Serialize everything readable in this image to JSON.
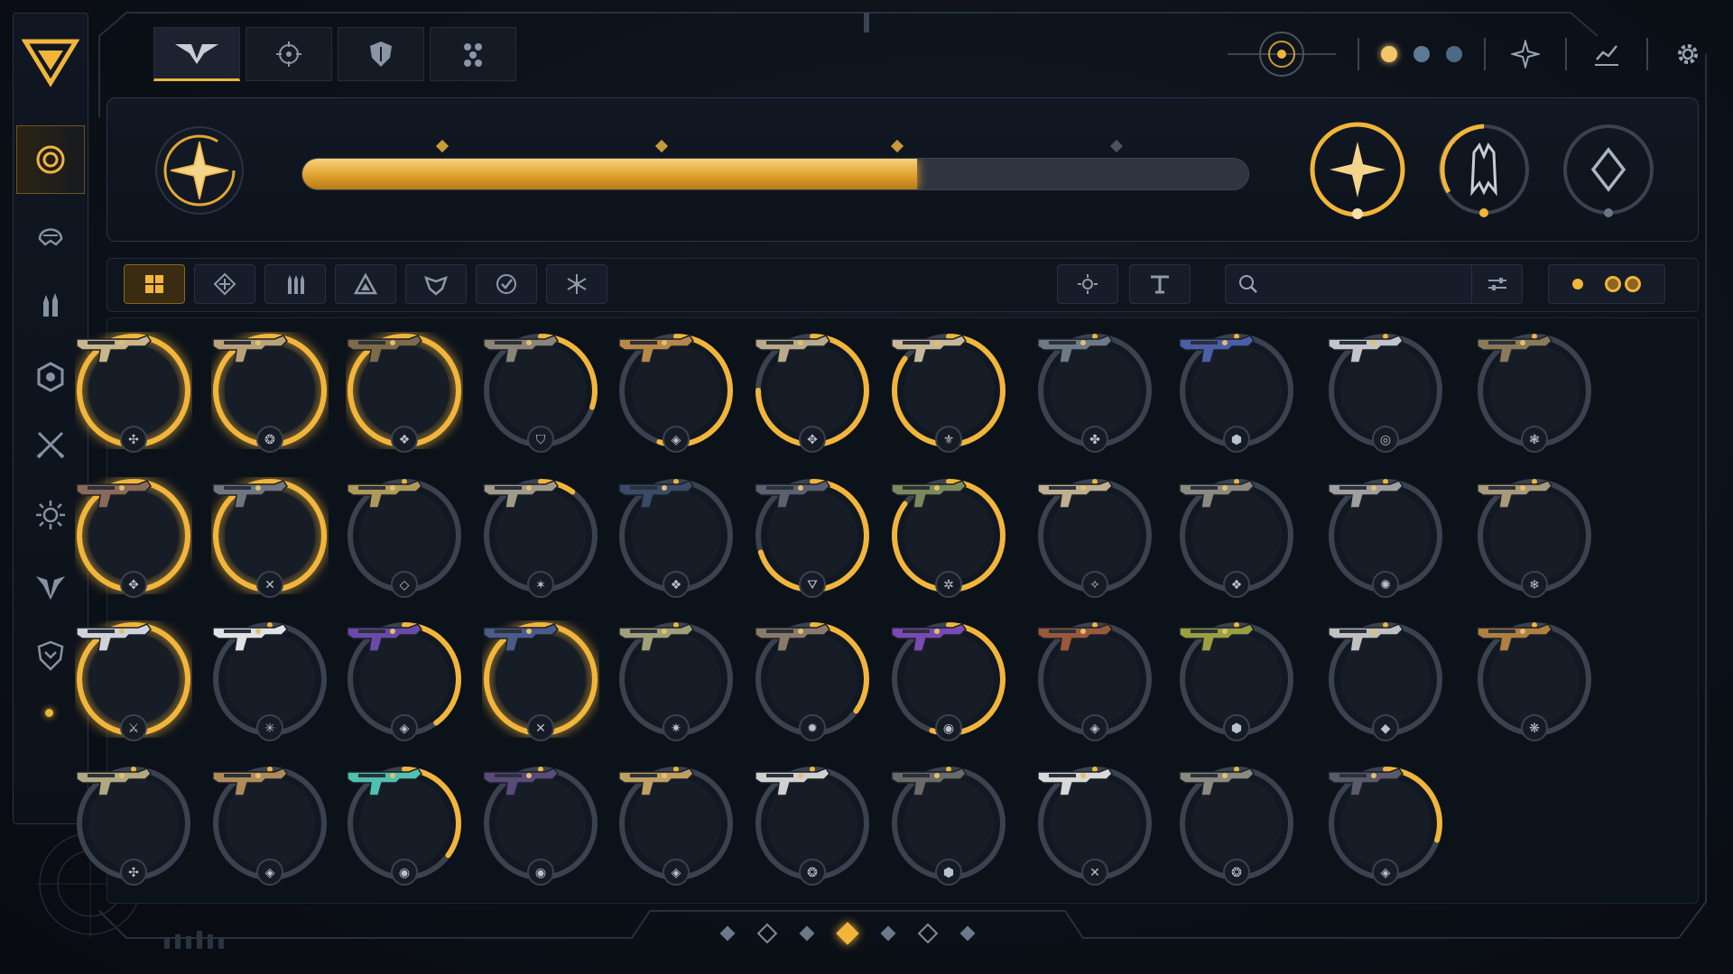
{
  "colors": {
    "gold": "#f2b53a",
    "ring_dim": "#3a4250",
    "bg": "#0b0f16"
  },
  "rail": {
    "logo": "triangle-emblem-icon",
    "items": [
      {
        "icon": "target-icon",
        "active": true
      },
      {
        "icon": "helmet-icon",
        "active": false
      },
      {
        "icon": "ammo-icon",
        "active": false
      },
      {
        "icon": "hexagon-icon",
        "active": false
      },
      {
        "icon": "crossed-swords-icon",
        "active": false
      },
      {
        "icon": "sunburst-icon",
        "active": false
      },
      {
        "icon": "winged-emblem-icon",
        "active": false
      },
      {
        "icon": "shield-crest-icon",
        "active": false
      }
    ]
  },
  "topnav": {
    "tabs": [
      {
        "icon": "wing-emblem-icon",
        "active": true
      },
      {
        "icon": "crosshair-icon",
        "active": false
      },
      {
        "icon": "shield-icon",
        "active": false
      },
      {
        "icon": "cluster-icon",
        "active": false
      }
    ]
  },
  "top_right": {
    "icons": [
      "radar-icon",
      "star-diamond-icon",
      "chart-icon",
      "gear-icon"
    ],
    "status_dots": [
      "#f4c66a",
      "#5c7a96",
      "#4b6a86"
    ]
  },
  "hero": {
    "emblem": "compass-star-icon",
    "progress": 0.65,
    "ranks": [
      {
        "icon": "compass-star-icon",
        "fill": 1.0
      },
      {
        "icon": "ghost-shell-icon",
        "fill": 0.55
      },
      {
        "icon": "diamond-icon",
        "fill": 0.0
      }
    ]
  },
  "filters": {
    "buttons": [
      {
        "icon": "grid-icon",
        "active": true
      },
      {
        "icon": "diamond-cross-icon",
        "active": false
      },
      {
        "icon": "bullets-icon",
        "active": false
      },
      {
        "icon": "triangle-icon",
        "active": false
      },
      {
        "icon": "crest-icon",
        "active": false
      },
      {
        "icon": "check-circle-icon",
        "active": false
      },
      {
        "icon": "snowflake-icon",
        "active": false
      }
    ],
    "sort_icons": [
      "sun-icon",
      "funnel-icon"
    ],
    "search_placeholder": "",
    "search_value": ""
  },
  "weapons": {
    "rows": [
      [
        {
          "fill": 1.0,
          "tint": "#c9b58a",
          "sym": "✣"
        },
        {
          "fill": 1.0,
          "tint": "#b9a27a",
          "sym": "❂"
        },
        {
          "fill": 1.0,
          "tint": "#7d6a48",
          "sym": "❖"
        },
        {
          "fill": 0.3,
          "tint": "#8a8578",
          "sym": "⛉"
        },
        {
          "fill": 0.55,
          "tint": "#b8874a",
          "sym": "◈"
        },
        {
          "fill": 0.75,
          "tint": "#b8aa8a",
          "sym": "✥"
        },
        {
          "fill": 0.85,
          "tint": "#c8b89a",
          "sym": "⚜"
        },
        {
          "fill": 0.0,
          "tint": "#6e7a88",
          "sym": "✤"
        },
        {
          "fill": 0.0,
          "tint": "#4b5fa8",
          "sym": "⬢"
        },
        {
          "fill": 0.0,
          "tint": "#c2c6cc",
          "sym": "◎"
        },
        {
          "fill": 0.0,
          "tint": "#8a7a5a",
          "sym": "❃"
        }
      ],
      [
        {
          "fill": 1.0,
          "tint": "#8a6a5a",
          "sym": "✥"
        },
        {
          "fill": 1.0,
          "tint": "#707680",
          "sym": "✕"
        },
        {
          "fill": 0.0,
          "tint": "#b09a5a",
          "sym": "◇"
        },
        {
          "fill": 0.1,
          "tint": "#a09a88",
          "sym": "✶"
        },
        {
          "fill": 0.0,
          "tint": "#3a4a6a",
          "sym": "❖"
        },
        {
          "fill": 0.7,
          "tint": "#5a6070",
          "sym": "⛛"
        },
        {
          "fill": 0.85,
          "tint": "#7a8a5a",
          "sym": "✲"
        },
        {
          "fill": 0.0,
          "tint": "#c0b090",
          "sym": "✧"
        },
        {
          "fill": 0.0,
          "tint": "#8a8a80",
          "sym": "❖"
        },
        {
          "fill": 0.0,
          "tint": "#a0a0a0",
          "sym": "✺"
        },
        {
          "fill": 0.0,
          "tint": "#a89a7a",
          "sym": "❄"
        }
      ],
      [
        {
          "fill": 1.0,
          "tint": "#d0d4da",
          "sym": "⚔"
        },
        {
          "fill": 0.0,
          "tint": "#e0e2e6",
          "sym": "✳"
        },
        {
          "fill": 0.4,
          "tint": "#6a4aa8",
          "sym": "◈"
        },
        {
          "fill": 1.0,
          "tint": "#4a5a8a",
          "sym": "✕"
        },
        {
          "fill": 0.0,
          "tint": "#a0a078",
          "sym": "✷"
        },
        {
          "fill": 0.35,
          "tint": "#8a7a6a",
          "sym": "✹"
        },
        {
          "fill": 0.55,
          "tint": "#7a4ab0",
          "sym": "◉"
        },
        {
          "fill": 0.0,
          "tint": "#9a5a3a",
          "sym": "◈"
        },
        {
          "fill": 0.0,
          "tint": "#9aa040",
          "sym": "⬢"
        },
        {
          "fill": 0.0,
          "tint": "#c0c0c0",
          "sym": "◆"
        },
        {
          "fill": 0.0,
          "tint": "#b08040",
          "sym": "❋"
        }
      ],
      [
        {
          "fill": 0.0,
          "tint": "#b0a880",
          "sym": "✣"
        },
        {
          "fill": 0.0,
          "tint": "#b08a5a",
          "sym": "◈"
        },
        {
          "fill": 0.35,
          "tint": "#50c0b0",
          "sym": "◉"
        },
        {
          "fill": 0.0,
          "tint": "#5a4a7a",
          "sym": "◉"
        },
        {
          "fill": 0.0,
          "tint": "#c0a060",
          "sym": "◈"
        },
        {
          "fill": 0.0,
          "tint": "#d0d0d0",
          "sym": "❂"
        },
        {
          "fill": 0.0,
          "tint": "#6a6a6a",
          "sym": "⬢"
        },
        {
          "fill": 0.0,
          "tint": "#d8d8d8",
          "sym": "✕"
        },
        {
          "fill": 0.0,
          "tint": "#8a8a80",
          "sym": "❂"
        },
        {
          "fill": 0.3,
          "tint": "#5a5a6a",
          "sym": "◈"
        }
      ]
    ]
  },
  "pager": {
    "count": 7,
    "active": 3
  }
}
